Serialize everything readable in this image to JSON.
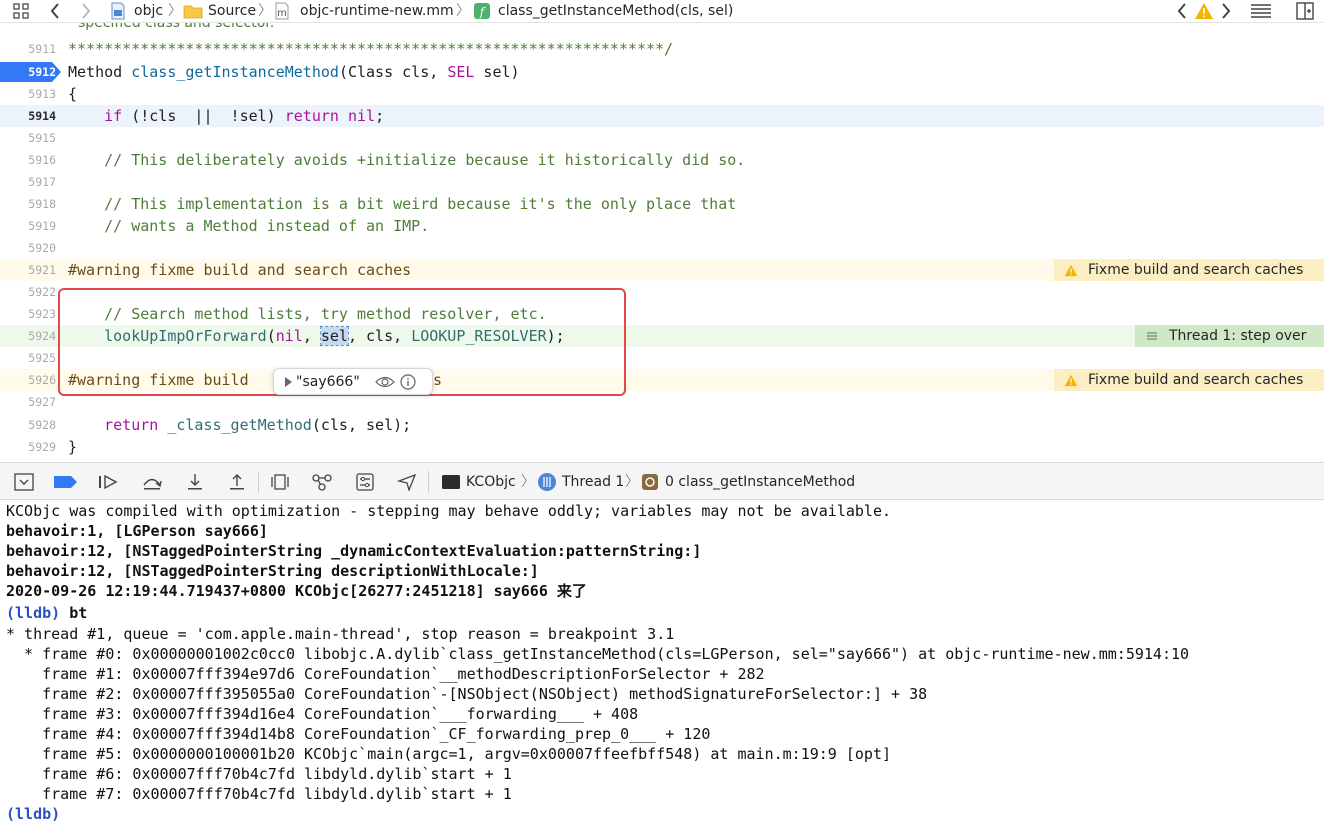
{
  "jumpbar": {
    "project": "objc",
    "folder": "Source",
    "file": "objc-runtime-new.mm",
    "symbol": "class_getInstanceMethod(cls, sel)",
    "file_icon_letter": "m",
    "symbol_icon_letter": "f",
    "icons": [
      "grid-icon",
      "back-arrow-icon",
      "forward-arrow-icon",
      "project-icon",
      "folder-icon",
      "file-icon",
      "function-icon",
      "prev-issue-icon",
      "warning-icon",
      "next-issue-icon",
      "editor-options-icon",
      "add-editor-icon"
    ]
  },
  "editor": {
    "partial_top_comment": "specified class and selector.",
    "lines": [
      {
        "num": "5911",
        "text": "******************************************************************/"
      },
      {
        "num": "5912"
      },
      {
        "num": "5913",
        "text": "{"
      },
      {
        "num": "5914"
      },
      {
        "num": "5915",
        "text": ""
      },
      {
        "num": "5916",
        "text": "    // This deliberately avoids +initialize because it historically did so."
      },
      {
        "num": "5917",
        "text": ""
      },
      {
        "num": "5918",
        "text": "    // This implementation is a bit weird because it's the only place that"
      },
      {
        "num": "5919",
        "text": "    // wants a Method instead of an IMP."
      },
      {
        "num": "5920",
        "text": ""
      },
      {
        "num": "5921",
        "text": "#warning fixme build and search caches"
      },
      {
        "num": "5922",
        "text": ""
      },
      {
        "num": "5923",
        "text": "    // Search method lists, try method resolver, etc."
      },
      {
        "num": "5924"
      },
      {
        "num": "5925",
        "text": ""
      },
      {
        "num": "5926",
        "text_before": "#warning fixme build ",
        "text_after": "s"
      },
      {
        "num": "5927",
        "text": ""
      },
      {
        "num": "5928"
      },
      {
        "num": "5929",
        "text": "}"
      }
    ],
    "line_5912": {
      "ret_type": "Method",
      "name": "class_getInstanceMethod",
      "open": "(",
      "p1_type": "Class",
      "p1": " cls, ",
      "p2_type": "SEL",
      "p2": " sel)"
    },
    "line_5914": {
      "indent": "    ",
      "if": "if",
      "cond": " (!cls  ||  !sel) ",
      "return": "return",
      "nil": "nil",
      "end": ";"
    },
    "line_5924": {
      "indent": "    ",
      "fn": "lookUpImpOrForward",
      "open": "(",
      "nil": "nil",
      "sep1": ", ",
      "sel": "sel",
      "rest": ", cls, ",
      "macro": "LOOKUP_RESOLVER",
      "end": ");"
    },
    "line_5928": {
      "indent": "    ",
      "return": "return",
      "sp": " ",
      "fn": "_class_getMethod",
      "args": "(cls, sel);"
    },
    "issues": {
      "warning_5921": "Fixme build and search caches",
      "warning_5926": "Fixme build and search caches",
      "thread_5924": "Thread 1: step over"
    },
    "popover": {
      "value": "\"say666\""
    }
  },
  "debug_toolbar": {
    "target": "KCObjc",
    "thread": "Thread 1",
    "frame": "0 class_getInstanceMethod",
    "icons": [
      "hide-debug-area-icon",
      "breakpoints-toggle-icon",
      "continue-icon",
      "step-over-icon",
      "step-into-icon",
      "step-out-icon",
      "view-hierarchy-icon",
      "memory-graph-icon",
      "environment-overrides-icon",
      "simulate-location-icon",
      "terminal-icon",
      "thread-icon",
      "frame-icon"
    ]
  },
  "console": {
    "lines": [
      {
        "text": "KCObjc was compiled with optimization - stepping may behave oddly; variables may not be available.",
        "style": "normal"
      },
      {
        "text": "behavoir:1, [LGPerson say666]",
        "style": "bold"
      },
      {
        "text": "behavoir:12, [NSTaggedPointerString _dynamicContextEvaluation:patternString:]",
        "style": "bold"
      },
      {
        "text": "behavoir:12, [NSTaggedPointerString descriptionWithLocale:]",
        "style": "bold"
      },
      {
        "text": "2020-09-26 12:19:44.719437+0800 KCObjc[26277:2451218] say666 来了",
        "style": "bold"
      },
      {
        "prompt": "(lldb)",
        "cmd": " bt",
        "style": "prompt"
      },
      {
        "text": "* thread #1, queue = 'com.apple.main-thread', stop reason = breakpoint 3.1",
        "style": "normal"
      },
      {
        "text": "  * frame #0: 0x00000001002c0cc0 libobjc.A.dylib`class_getInstanceMethod(cls=LGPerson, sel=\"say666\") at objc-runtime-new.mm:5914:10",
        "style": "normal"
      },
      {
        "text": "    frame #1: 0x00007fff394e97d6 CoreFoundation`__methodDescriptionForSelector + 282",
        "style": "normal"
      },
      {
        "text": "    frame #2: 0x00007fff395055a0 CoreFoundation`-[NSObject(NSObject) methodSignatureForSelector:] + 38",
        "style": "normal"
      },
      {
        "text": "    frame #3: 0x00007fff394d16e4 CoreFoundation`___forwarding___ + 408",
        "style": "normal"
      },
      {
        "text": "    frame #4: 0x00007fff394d14b8 CoreFoundation`_CF_forwarding_prep_0___ + 120",
        "style": "normal"
      },
      {
        "text": "    frame #5: 0x0000000100001b20 KCObjc`main(argc=1, argv=0x00007ffeefbff548) at main.m:19:9 [opt]",
        "style": "normal"
      },
      {
        "text": "    frame #6: 0x00007fff70b4c7fd libdyld.dylib`start + 1",
        "style": "normal"
      },
      {
        "text": "    frame #7: 0x00007fff70b4c7fd libdyld.dylib`start + 1",
        "style": "normal"
      },
      {
        "prompt": "(lldb)",
        "cmd": "",
        "style": "prompt"
      }
    ]
  },
  "colors": {
    "keyword": "#a8139a",
    "function": "#326d74",
    "comment": "#4e7d39",
    "breakpoint": "#3478f6",
    "warning_bg": "#fbeec3",
    "thread_bg": "#cfe9c8",
    "highlight_box": "#e24848",
    "lldb_prompt": "#2a52be"
  }
}
